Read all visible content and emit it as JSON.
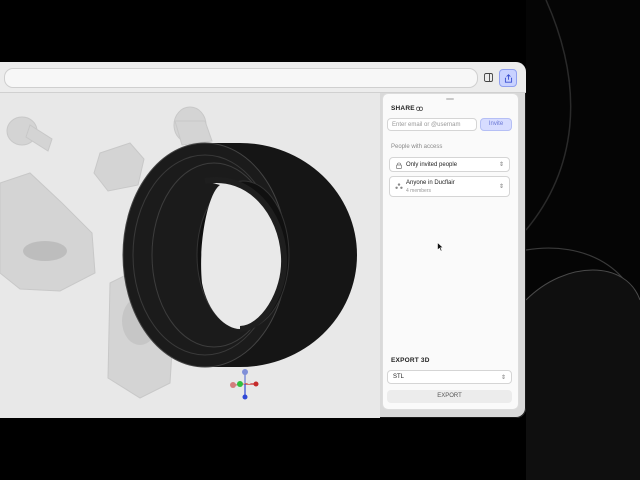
{
  "share": {
    "title": "SHARE",
    "invite_placeholder": "Enter email or @usernam",
    "invite_label": "Invite",
    "people_label": "People with access",
    "access_option": "Only invited people",
    "org_name": "Anyone in Ducflair",
    "org_members": "4 members"
  },
  "export": {
    "title": "EXPORT 3D",
    "format": "STL",
    "button_label": "EXPORT"
  },
  "colors": {
    "accent": "#c9d2ff",
    "accent_text": "#6b78d6",
    "model": "#111111",
    "viewport_bg": "#e8e8e8"
  },
  "icons": [
    "sidebar-toggle-icon",
    "share-icon",
    "link-icon",
    "lock-icon",
    "group-icon",
    "chevron-updown-icon",
    "cursor-icon",
    "axis-gizmo-icon"
  ]
}
